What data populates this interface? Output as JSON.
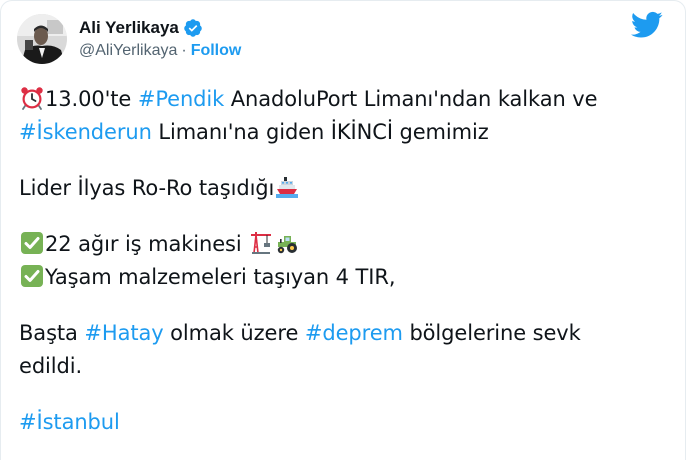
{
  "user": {
    "display_name": "Ali Yerlikaya",
    "handle": "@AliYerlikaya",
    "separator": "·",
    "follow_label": "Follow"
  },
  "colors": {
    "link": "#1d9bf0",
    "text": "#0f1419",
    "muted": "#536471"
  },
  "tweet": {
    "line1": {
      "icon": "alarm-clock-icon",
      "time": "13.00'te ",
      "tag": "#Pendik",
      "rest": " AnadoluPort Limanı'ndan kalkan ve"
    },
    "line2": {
      "tag": "#İskenderun",
      "rest": " Limanı'na giden İKİNCİ gemimiz"
    },
    "line3": {
      "text": "Lider İlyas Ro-Ro taşıdığı",
      "icon": "ship-icon"
    },
    "line4": {
      "check_icon": "check-mark-icon",
      "text": "22 ağır iş makinesi ",
      "icons": [
        "crane-icon",
        "tractor-icon"
      ]
    },
    "line5": {
      "check_icon": "check-mark-icon",
      "text": "Yaşam malzemeleri taşıyan 4 TIR,"
    },
    "line6": {
      "prefix": "Başta ",
      "tag1": "#Hatay",
      "middle": " olmak üzere ",
      "tag2": "#deprem",
      "rest": " bölgelerine sevk"
    },
    "line7": {
      "text": "edildi."
    },
    "line8": {
      "tag": "#İstanbul"
    }
  }
}
